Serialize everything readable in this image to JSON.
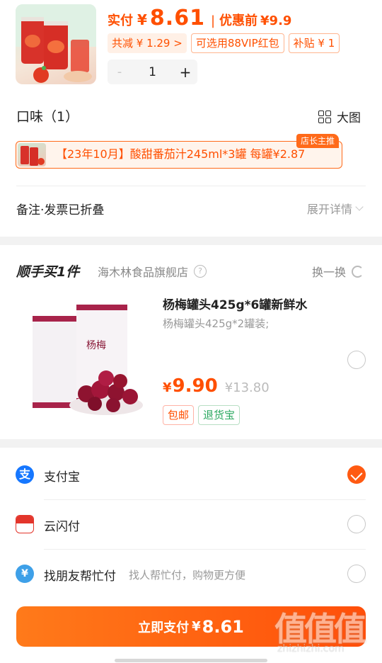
{
  "product": {
    "pay_label": "实付",
    "currency": "¥",
    "pay_amount": "8.61",
    "separator": "|",
    "before_discount_label": "优惠前",
    "before_discount_amount": "¥9.9",
    "tags": [
      "共减 ¥ 1.29 >",
      "可选用88VIP红包",
      "补贴 ¥ 1"
    ],
    "quantity": "1",
    "minus": "-",
    "plus": "+"
  },
  "flavor": {
    "title": "口味（1）",
    "big_image_label": "大图",
    "option_text": "【23年10月】酸甜番茄汁245ml*3罐  每罐¥2.87",
    "badge": "店长主推"
  },
  "note": {
    "label": "备注·发票已折叠",
    "expand_label": "展开详情"
  },
  "addon": {
    "title": "顺手买1件",
    "shop": "海木林食品旗舰店",
    "help": "?",
    "swap_label": "换一换",
    "name": "杨梅罐头425g*6罐新鲜水",
    "spec": "杨梅罐头425g*2罐装;",
    "currency": "¥",
    "price": "9.90",
    "original_price": "¥13.80",
    "tags": [
      "包邮",
      "退货宝"
    ],
    "can_label": "杨梅"
  },
  "payment": {
    "methods": [
      {
        "name": "支付宝",
        "desc": "",
        "selected": true,
        "icon": "alipay-icon"
      },
      {
        "name": "云闪付",
        "desc": "",
        "selected": false,
        "icon": "unionpay-icon"
      },
      {
        "name": "找朋友帮忙付",
        "desc": "找人帮忙付，购物更方便",
        "selected": false,
        "icon": "friend-pay-icon"
      }
    ],
    "button_label": "立即支付",
    "button_currency": "¥",
    "button_amount": "8.61"
  },
  "watermark": {
    "text": "值值值",
    "url": "zhizhizhi.com"
  },
  "colors": {
    "accent": "#ff4f00",
    "button_start": "#ff7a1a",
    "button_end": "#ff4f0a",
    "green_tag": "#2ba860"
  }
}
